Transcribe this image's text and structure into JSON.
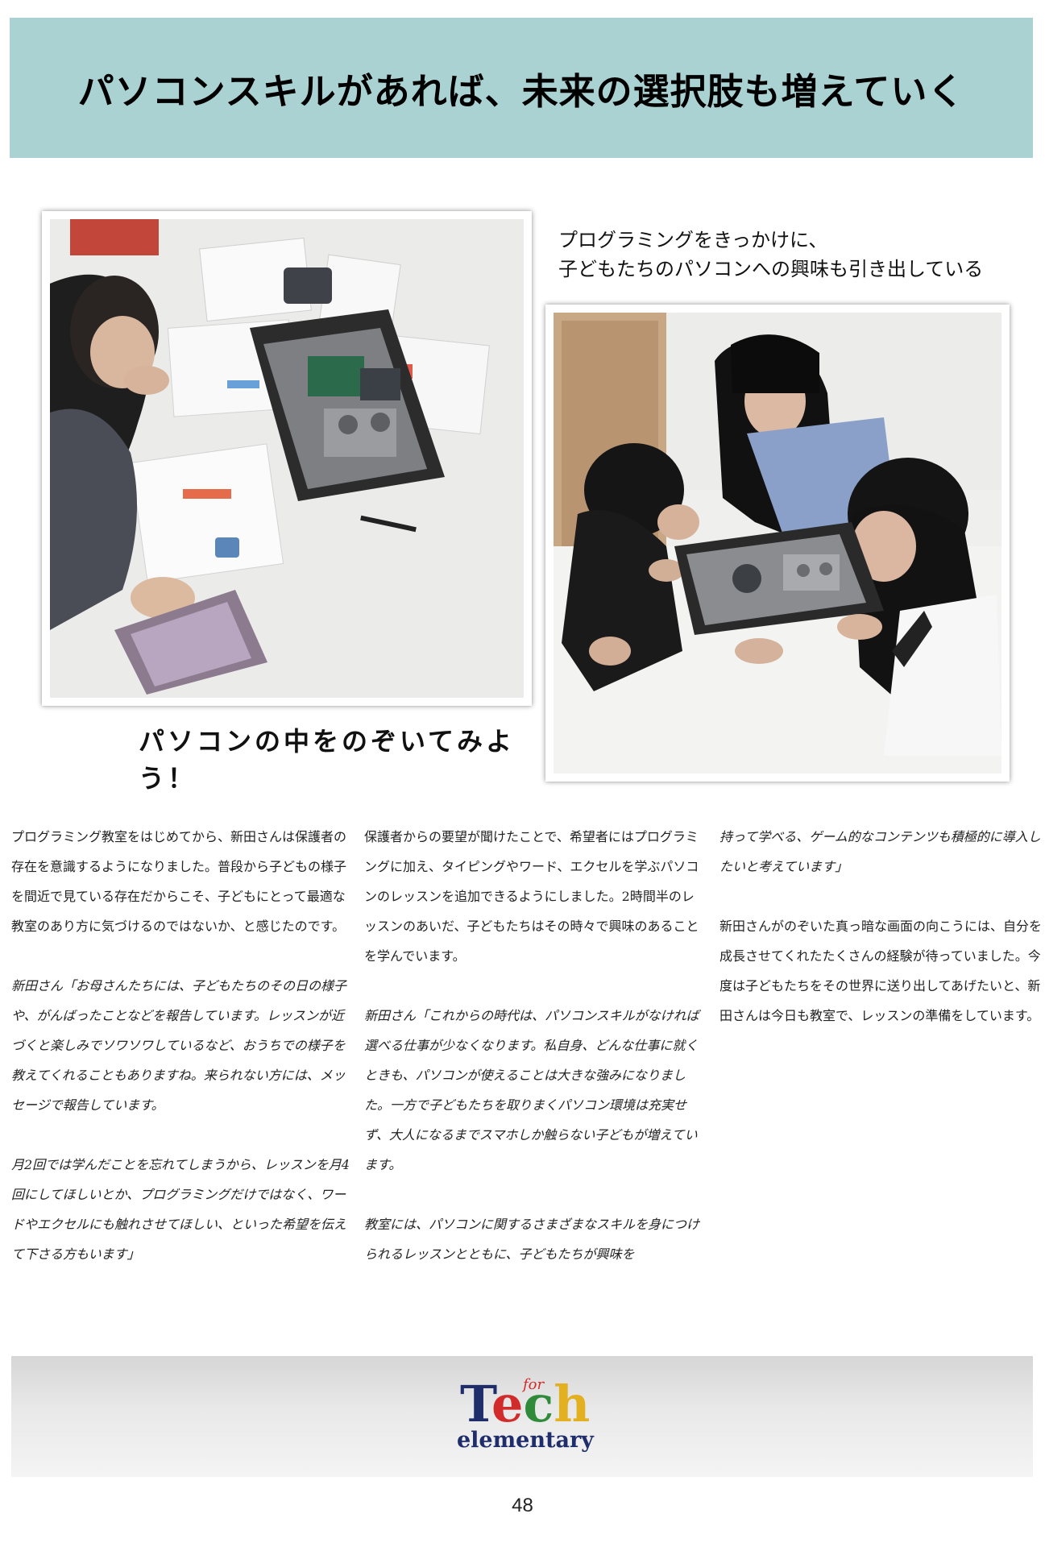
{
  "header": {
    "title": "パソコンスキルがあれば、未来の選択肢も増えていく"
  },
  "photos": {
    "right_caption_line1": "プログラミングをきっかけに、",
    "right_caption_line2": "子どもたちのパソコンへの興味も引き出している",
    "left_caption": "パソコンの中をのぞいてみよう！"
  },
  "article": {
    "col1": [
      "プログラミング教室をはじめてから、新田さんは保護者の存在を意識するようになりました。普段から子どもの様子を間近で見ている存在だからこそ、子どもにとって最適な教室のあり方に気づけるのではないか、と感じたのです。",
      "新田さん「お母さんたちには、子どもたちのその日の様子や、がんばったことなどを報告しています。レッスンが近づくと楽しみでソワソワしているなど、おうちでの様子を教えてくれることもありますね。来られない方には、メッセージで報告しています。",
      "月2回では学んだことを忘れてしまうから、レッスンを月4回にしてほしいとか、プログラミングだけではなく、ワードやエクセルにも触れさせてほしい、といった希望を伝えて下さる方もいます」"
    ],
    "col2": [
      "保護者からの要望が聞けたことで、希望者にはプログラミングに加え、タイピングやワード、エクセルを学ぶパソコンのレッスンを追加できるようにしました。2時間半のレッスンのあいだ、子どもたちはその時々で興味のあることを学んでいます。",
      "新田さん「これからの時代は、パソコンスキルがなければ選べる仕事が少なくなります。私自身、どんな仕事に就くときも、パソコンが使えることは大きな強みになりました。一方で子どもたちを取りまくパソコン環境は充実せず、大人になるまでスマホしか触らない子どもが増えています。",
      "教室には、パソコンに関するさまざまなスキルを身につけられるレッスンとともに、子どもたちが興味を"
    ],
    "col3": [
      "持って学べる、ゲーム的なコンテンツも積極的に導入したいと考えています」",
      "新田さんがのぞいた真っ暗な画面の向こうには、自分を成長させてくれたたくさんの経験が待っていました。今度は子どもたちをその世界に送り出してあげたいと、新田さんは今日も教室で、レッスンの準備をしています。"
    ]
  },
  "footer": {
    "logo_tech_t": "T",
    "logo_tech_e": "e",
    "logo_tech_c": "c",
    "logo_tech_h": "h",
    "logo_for": "for",
    "logo_elementary": "elementary",
    "page_number": "48"
  }
}
